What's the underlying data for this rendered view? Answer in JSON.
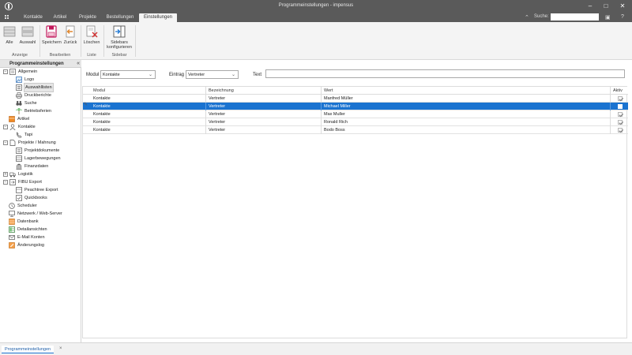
{
  "window": {
    "title": "Programmeinstellungen - impensus",
    "controls": {
      "minimize": "–",
      "maximize": "□",
      "close": "✕"
    }
  },
  "tabs": [
    {
      "label": "Kontakte"
    },
    {
      "label": "Artikel"
    },
    {
      "label": "Projekte"
    },
    {
      "label": "Bestellungen"
    },
    {
      "label": "Einstellungen",
      "active": true
    }
  ],
  "search": {
    "label": "Suche:",
    "value": ""
  },
  "ribbon": {
    "groups": [
      {
        "label": "Anzeige",
        "buttons": [
          {
            "label": "Alle"
          },
          {
            "label": "Auswahl"
          }
        ]
      },
      {
        "label": "Bearbeiten",
        "buttons": [
          {
            "label": "Speichern"
          },
          {
            "label": "Zurück"
          }
        ]
      },
      {
        "label": "Liste",
        "buttons": [
          {
            "label": "Löschen"
          }
        ]
      },
      {
        "label": "Sidebar",
        "buttons": [
          {
            "label": "Sidebars konfigurieren"
          }
        ]
      }
    ]
  },
  "sidebar": {
    "title": "Programmeinstellungen",
    "collapse": "«",
    "items": [
      {
        "label": "Allgemein",
        "expander": "−"
      },
      {
        "label": "Logo"
      },
      {
        "label": "Auswahllisten",
        "selected": true
      },
      {
        "label": "Druckberichte"
      },
      {
        "label": "Suche"
      },
      {
        "label": "Betriebsferien"
      },
      {
        "label": "Artikel"
      },
      {
        "label": "Kontakte",
        "expander": "−"
      },
      {
        "label": "Tapi"
      },
      {
        "label": "Projekte / Mahnung",
        "expander": "−"
      },
      {
        "label": "Projektdokumente"
      },
      {
        "label": "Lagerbewegungen"
      },
      {
        "label": "Finanzdaten"
      },
      {
        "label": "Logistik",
        "expander": "+"
      },
      {
        "label": "FIBU Export",
        "expander": "−"
      },
      {
        "label": "Peachtree Export"
      },
      {
        "label": "Quickbooks"
      },
      {
        "label": "Scheduler"
      },
      {
        "label": "Netzwerk / Web-Server"
      },
      {
        "label": "Datenbank"
      },
      {
        "label": "Detailansichten"
      },
      {
        "label": "E-Mail Konten"
      },
      {
        "label": "Änderungslog"
      }
    ]
  },
  "filter": {
    "modul_label": "Modul",
    "modul_value": "Kontakte",
    "eintrag_label": "Eintrag",
    "eintrag_value": "Vertreter",
    "text_label": "Text",
    "text_value": ""
  },
  "grid": {
    "columns": [
      "Modul",
      "Bezeichnung",
      "Wert",
      "Aktiv"
    ],
    "rows": [
      {
        "modul": "Kontakte",
        "bezeichnung": "Vertreter",
        "wert": "Manfred Müller",
        "aktiv": true
      },
      {
        "modul": "Kontakte",
        "bezeichnung": "Vertreter",
        "wert": "Michael Miller",
        "aktiv": false,
        "selected": true
      },
      {
        "modul": "Kontakte",
        "bezeichnung": "Vertreter",
        "wert": "Max Muller",
        "aktiv": true
      },
      {
        "modul": "Kontakte",
        "bezeichnung": "Vertreter",
        "wert": "Ronald Rich",
        "aktiv": true
      },
      {
        "modul": "Kontakte",
        "bezeichnung": "Vertreter",
        "wert": "Bodo Boss",
        "aktiv": true
      }
    ]
  },
  "statusbar": {
    "tab_label": "Programmeinstellungen",
    "close": "×"
  },
  "colors": {
    "accent": "#1a73d0",
    "titlebar": "#5a5a5a",
    "ribbon": "#f4f4f4"
  }
}
